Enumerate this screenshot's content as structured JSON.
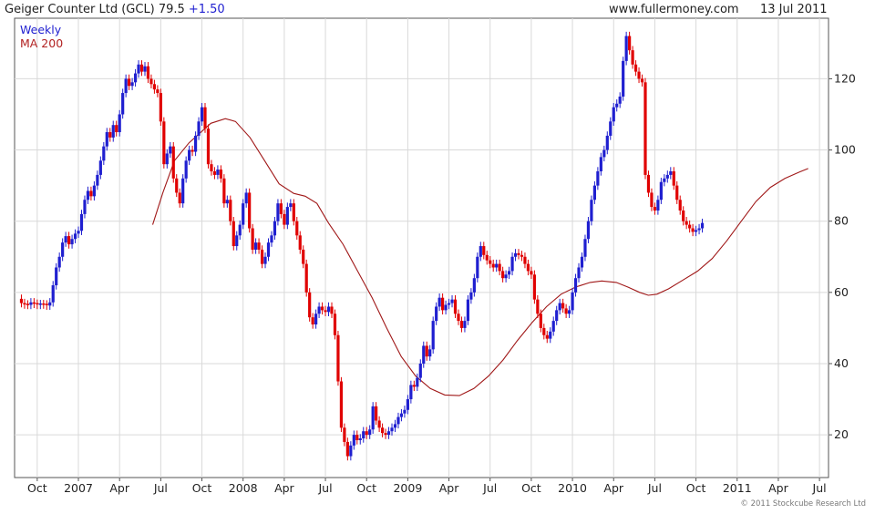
{
  "header": {
    "title": "Geiger Counter Ltd (GCL) 79.5",
    "change": "+1.50",
    "site": "www.fullermoney.com",
    "date": "13 Jul 2011"
  },
  "footer": {
    "copyright": "© 2011 Stockcube Research Ltd"
  },
  "colors": {
    "up": "#1f1fd0",
    "down": "#e00000",
    "ma": "#a01818",
    "grid": "#d9d9d9",
    "change": "#1f1fd0"
  },
  "chart_data": {
    "type": "line",
    "title": "Geiger Counter Ltd (GCL) 79.5 +1.50",
    "legend": [
      "Weekly",
      "MA 200"
    ],
    "legend_position": "top-left",
    "grid": true,
    "ylim": [
      8,
      137
    ],
    "y_ticks": [
      20,
      40,
      60,
      80,
      100,
      120
    ],
    "x_tick_labels": [
      "Oct",
      "2007",
      "Apr",
      "Jul",
      "Oct",
      "2008",
      "Apr",
      "Jul",
      "Oct",
      "2009",
      "Apr",
      "Jul",
      "Oct",
      "2010",
      "Apr",
      "Jul",
      "Oct",
      "2011",
      "Apr",
      "Jul"
    ],
    "x_tick_index": [
      6,
      19,
      32,
      45,
      58,
      71,
      84,
      97,
      110,
      123,
      136,
      149,
      162,
      175,
      188,
      201,
      214,
      227,
      240,
      253
    ],
    "week_count": 257,
    "series": [
      {
        "name": "Weekly",
        "kind": "weekly close",
        "values": [
          58.2,
          57.0,
          56.6,
          56.5,
          57.2,
          56.8,
          56.5,
          56.7,
          56.6,
          56.3,
          57.2,
          62.0,
          67.0,
          70.0,
          74.0,
          75.8,
          73.5,
          75.0,
          76.5,
          77.3,
          82.0,
          86.0,
          88.5,
          87.0,
          90.0,
          93.0,
          97.0,
          101.0,
          105.0,
          103.5,
          107.0,
          105.0,
          110.0,
          116.0,
          120.0,
          118.0,
          119.0,
          121.5,
          124.0,
          122.0,
          123.5,
          120.0,
          118.5,
          117.0,
          116.0,
          108.0,
          96.0,
          99.0,
          101.0,
          92.0,
          88.0,
          85.0,
          92.0,
          97.0,
          100.0,
          99.5,
          104.0,
          108.0,
          112.0,
          106.0,
          96.0,
          94.0,
          93.0,
          94.5,
          92.0,
          85.0,
          86.0,
          80.0,
          73.0,
          76.0,
          79.0,
          85.0,
          88.0,
          78.0,
          72.0,
          74.0,
          72.0,
          68.0,
          70.0,
          74.0,
          76.0,
          80.0,
          85.0,
          82.0,
          79.0,
          84.0,
          85.0,
          80.0,
          76.0,
          72.0,
          68.0,
          60.0,
          53.0,
          51.0,
          54.0,
          56.0,
          55.0,
          54.5,
          56.0,
          54.0,
          48.0,
          35.0,
          22.0,
          18.0,
          14.0,
          17.0,
          20.0,
          18.5,
          19.0,
          21.0,
          20.0,
          21.5,
          28.0,
          24.0,
          22.0,
          20.5,
          20.0,
          21.0,
          22.0,
          23.0,
          25.0,
          26.0,
          27.0,
          30.0,
          34.0,
          33.5,
          36.0,
          40.0,
          45.0,
          42.0,
          44.0,
          52.0,
          56.0,
          58.5,
          55.0,
          56.5,
          57.0,
          58.0,
          54.0,
          52.0,
          50.0,
          52.0,
          58.0,
          60.0,
          64.0,
          70.0,
          73.0,
          70.5,
          69.0,
          68.0,
          67.0,
          68.0,
          66.0,
          64.0,
          65.0,
          66.0,
          70.0,
          71.0,
          70.5,
          70.0,
          68.0,
          66.0,
          65.0,
          58.0,
          54.0,
          50.0,
          48.0,
          47.0,
          49.0,
          52.0,
          55.0,
          57.0,
          55.5,
          54.0,
          55.0,
          60.0,
          64.0,
          67.0,
          70.0,
          75.0,
          80.0,
          86.0,
          90.0,
          94.0,
          98.0,
          100.0,
          104.0,
          108.0,
          112.0,
          113.0,
          115.0,
          125.0,
          132.0,
          128.0,
          124.0,
          122.0,
          120.0,
          119.0,
          93.0,
          88.0,
          84.0,
          83.0,
          86.0,
          91.0,
          92.0,
          93.0,
          94.0,
          90.0,
          86.0,
          83.0,
          80.0,
          79.0,
          78.0,
          77.0,
          77.5,
          78.0,
          79.5
        ]
      },
      {
        "name": "MA 200",
        "kind": "moving average",
        "points": [
          [
            95,
            79.0
          ],
          [
            102,
            88.0
          ],
          [
            110,
            97.0
          ],
          [
            120,
            102.0
          ],
          [
            135,
            107.5
          ],
          [
            145,
            108.8
          ],
          [
            152,
            108.0
          ],
          [
            162,
            103.5
          ],
          [
            172,
            97.0
          ],
          [
            182,
            90.5
          ],
          [
            192,
            87.8
          ],
          [
            200,
            87.0
          ],
          [
            208,
            85.0
          ],
          [
            216,
            79.5
          ],
          [
            226,
            73.5
          ],
          [
            236,
            66.0
          ],
          [
            246,
            58.5
          ],
          [
            256,
            50.0
          ],
          [
            266,
            42.0
          ],
          [
            276,
            36.5
          ],
          [
            286,
            33.0
          ],
          [
            296,
            31.2
          ],
          [
            306,
            31.0
          ],
          [
            316,
            33.0
          ],
          [
            326,
            36.5
          ],
          [
            336,
            41.0
          ],
          [
            346,
            46.5
          ],
          [
            356,
            51.5
          ],
          [
            366,
            56.0
          ],
          [
            376,
            59.5
          ],
          [
            386,
            61.5
          ],
          [
            396,
            62.8
          ],
          [
            404,
            63.2
          ],
          [
            414,
            62.8
          ],
          [
            422,
            61.5
          ],
          [
            430,
            60.0
          ],
          [
            436,
            59.2
          ],
          [
            442,
            59.5
          ],
          [
            450,
            61.0
          ],
          [
            460,
            63.5
          ],
          [
            470,
            66.0
          ],
          [
            480,
            69.5
          ],
          [
            490,
            74.5
          ],
          [
            500,
            80.0
          ],
          [
            510,
            85.5
          ],
          [
            520,
            89.5
          ],
          [
            530,
            92.0
          ],
          [
            540,
            93.8
          ],
          [
            546,
            94.8
          ]
        ]
      }
    ]
  }
}
